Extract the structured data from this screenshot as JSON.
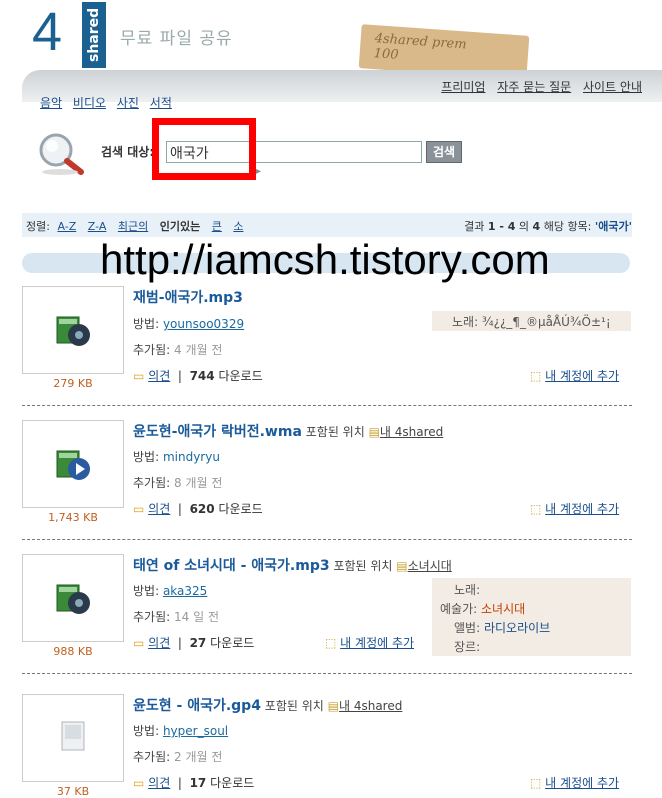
{
  "header": {
    "logo_number": "4",
    "logo_word": "shared",
    "tagline": "무료 파일 공유",
    "stamp_text": "4shared prem\n100"
  },
  "top_links": [
    "프리미엄",
    "자주 묻는 질문",
    "사이트 안내"
  ],
  "categories": [
    "음악",
    "비디오",
    "사진",
    "서적"
  ],
  "search": {
    "label": "검색 대상:",
    "value": "애국가",
    "button": "검색"
  },
  "sort": {
    "label": "정렬:",
    "options": [
      "A-Z",
      "Z-A",
      "최근의",
      "인기있는",
      "큰",
      "소"
    ],
    "active": "인기있는"
  },
  "result_info": {
    "prefix": "결과",
    "range": "1 - 4",
    "middle": "의",
    "count": "4",
    "suffix": "해당 항목:",
    "query": "'애국가'"
  },
  "watermark": "http://iamcsh.tistory.com",
  "labels": {
    "method": "방법:",
    "added": "추가됨:",
    "comment": "의견",
    "downloads": "다운로드",
    "add_account": "내 계정에 추가",
    "contained": "포함된 위치",
    "song": "노래:",
    "artist": "예술가:",
    "album": "앨범:",
    "genre": "장르:"
  },
  "results": [
    {
      "title": "재범-애국가.mp3",
      "size": "279 KB",
      "user": "younsoo0329",
      "added": "4 개월 전",
      "downloads": "744",
      "song_info": "노래: ¾¿¿_¶_®µåÅÚ¾Ö±¹¡",
      "icon": "music-file-icon"
    },
    {
      "title": "윤도현-애국가 락버전.wma",
      "size": "1,743 KB",
      "user": "mindyryu",
      "added": "8 개월 전",
      "downloads": "620",
      "folder": "내 4shared",
      "icon": "media-file-icon"
    },
    {
      "title": "태연 of 소녀시대 - 애국가.mp3",
      "size": "988 KB",
      "user": "aka325",
      "added": "14 일 전",
      "downloads": "27",
      "folder": "소녀시대",
      "artist": "소녀시대",
      "album": "라디오라이브",
      "icon": "music-file-icon"
    },
    {
      "title": "윤도현 - 애국가.gp4",
      "size": "37 KB",
      "user": "hyper_soul",
      "added": "2 개월 전",
      "downloads": "17",
      "folder": "내 4shared",
      "icon": "generic-file-icon"
    }
  ],
  "colors": {
    "brand_blue": "#1a6090",
    "highlight_red": "#ff0000",
    "size_orange": "#c06020"
  }
}
